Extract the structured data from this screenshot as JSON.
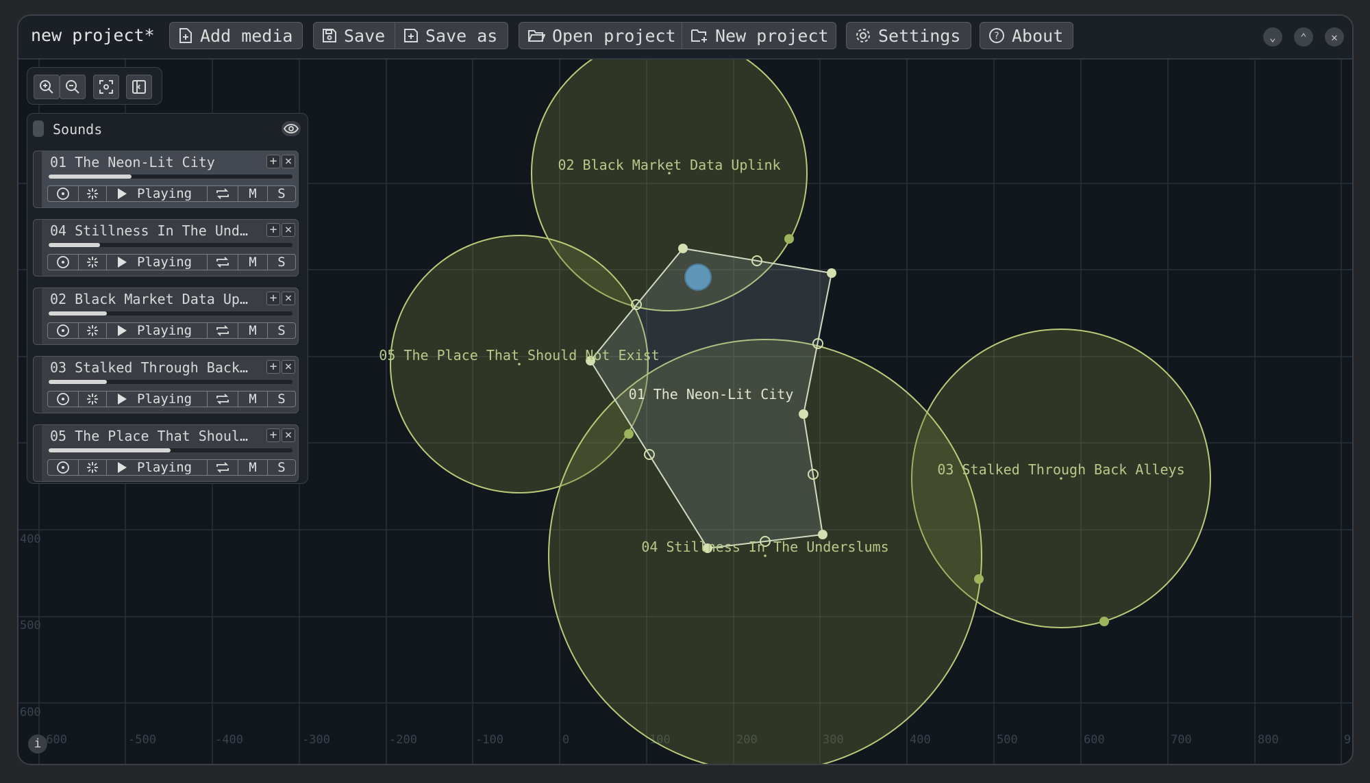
{
  "titlebar": {
    "title": "new project*",
    "buttons": [
      {
        "label": "Add media",
        "icon": "add-file-icon"
      },
      {
        "label": "Save",
        "icon": "save-icon"
      },
      {
        "label": "Save as",
        "icon": "save-as-icon"
      },
      {
        "label": "Open project",
        "icon": "folder-open-icon"
      },
      {
        "label": "New project",
        "icon": "folder-plus-icon"
      },
      {
        "label": "Settings",
        "icon": "gear-icon"
      },
      {
        "label": "About",
        "icon": "question-icon"
      }
    ],
    "window_controls": [
      "minimize",
      "maximize",
      "close"
    ]
  },
  "zoom_toolbar": [
    "zoom-in-icon",
    "zoom-out-icon",
    "fit-view-icon",
    "toggle-panel-icon"
  ],
  "sounds_panel": {
    "title": "Sounds",
    "tracks": [
      {
        "name": "01 The Neon-Lit City",
        "status": "Playing",
        "mute": "M",
        "solo": "S",
        "progress": 0.34,
        "selected": true
      },
      {
        "name": "04 Stillness In The Und…",
        "status": "Playing",
        "mute": "M",
        "solo": "S",
        "progress": 0.21,
        "selected": false
      },
      {
        "name": "02 Black Market Data Up…",
        "status": "Playing",
        "mute": "M",
        "solo": "S",
        "progress": 0.24,
        "selected": false
      },
      {
        "name": "03 Stalked Through Back…",
        "status": "Playing",
        "mute": "M",
        "solo": "S",
        "progress": 0.24,
        "selected": false
      },
      {
        "name": "05 The Place That Shoul…",
        "status": "Playing",
        "mute": "M",
        "solo": "S",
        "progress": 0.5,
        "selected": false
      }
    ]
  },
  "canvas": {
    "x_ticks": [
      "-600",
      "-500",
      "-400",
      "-300",
      "-200",
      "-100",
      "0",
      "100",
      "200",
      "300",
      "400",
      "500",
      "600",
      "700",
      "800",
      "9"
    ],
    "y_ticks": [
      "400",
      "500",
      "600"
    ],
    "sources": [
      {
        "label": "02 Black Market Data Uplink"
      },
      {
        "label": "05 The Place That Should Not Exist"
      },
      {
        "label": "01 The Neon-Lit City"
      },
      {
        "label": "03 Stalked Through Back Alleys"
      },
      {
        "label": "04 Stillness In The Underslums"
      }
    ],
    "colors": {
      "background": "#12161d",
      "grid": "#2a313a",
      "zone_fill": "#6b7a3a",
      "zone_stroke": "#b9cc7a",
      "label": "#b8c98a",
      "listener": "#5f96b8"
    }
  },
  "info_button": "i"
}
